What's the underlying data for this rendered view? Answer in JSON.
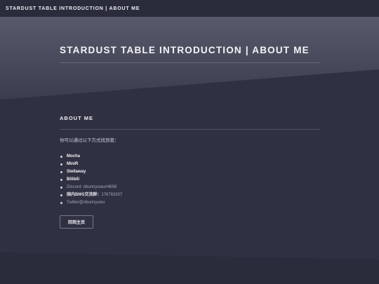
{
  "topbar": {
    "title": "STARDUST TABLE INTRODUCTION | ABOUT ME"
  },
  "hero": {
    "title": "STARDUST TABLE INTRODUCTION | ABOUT ME"
  },
  "section": {
    "title": "ABOUT ME",
    "intro": "你可以通过以下方式找到我："
  },
  "links": {
    "mocha": "Mocha",
    "minir": "MiniR",
    "stellaway": "Stellaway",
    "bilibili": "Bilibili",
    "discord": "Discord: nbunnyuwu#4698",
    "qq_label": "国内BMS交流群：",
    "qq_value": "176763307",
    "twitter": "Twitter@nbunnyuwu"
  },
  "home_button": {
    "label": "回到主页"
  },
  "colors": {
    "background": "#2f3142",
    "hero_top": "#545767",
    "hero_bottom": "#3a3c4d",
    "text": "#f0f0f5",
    "muted": "#a4a5b6"
  }
}
